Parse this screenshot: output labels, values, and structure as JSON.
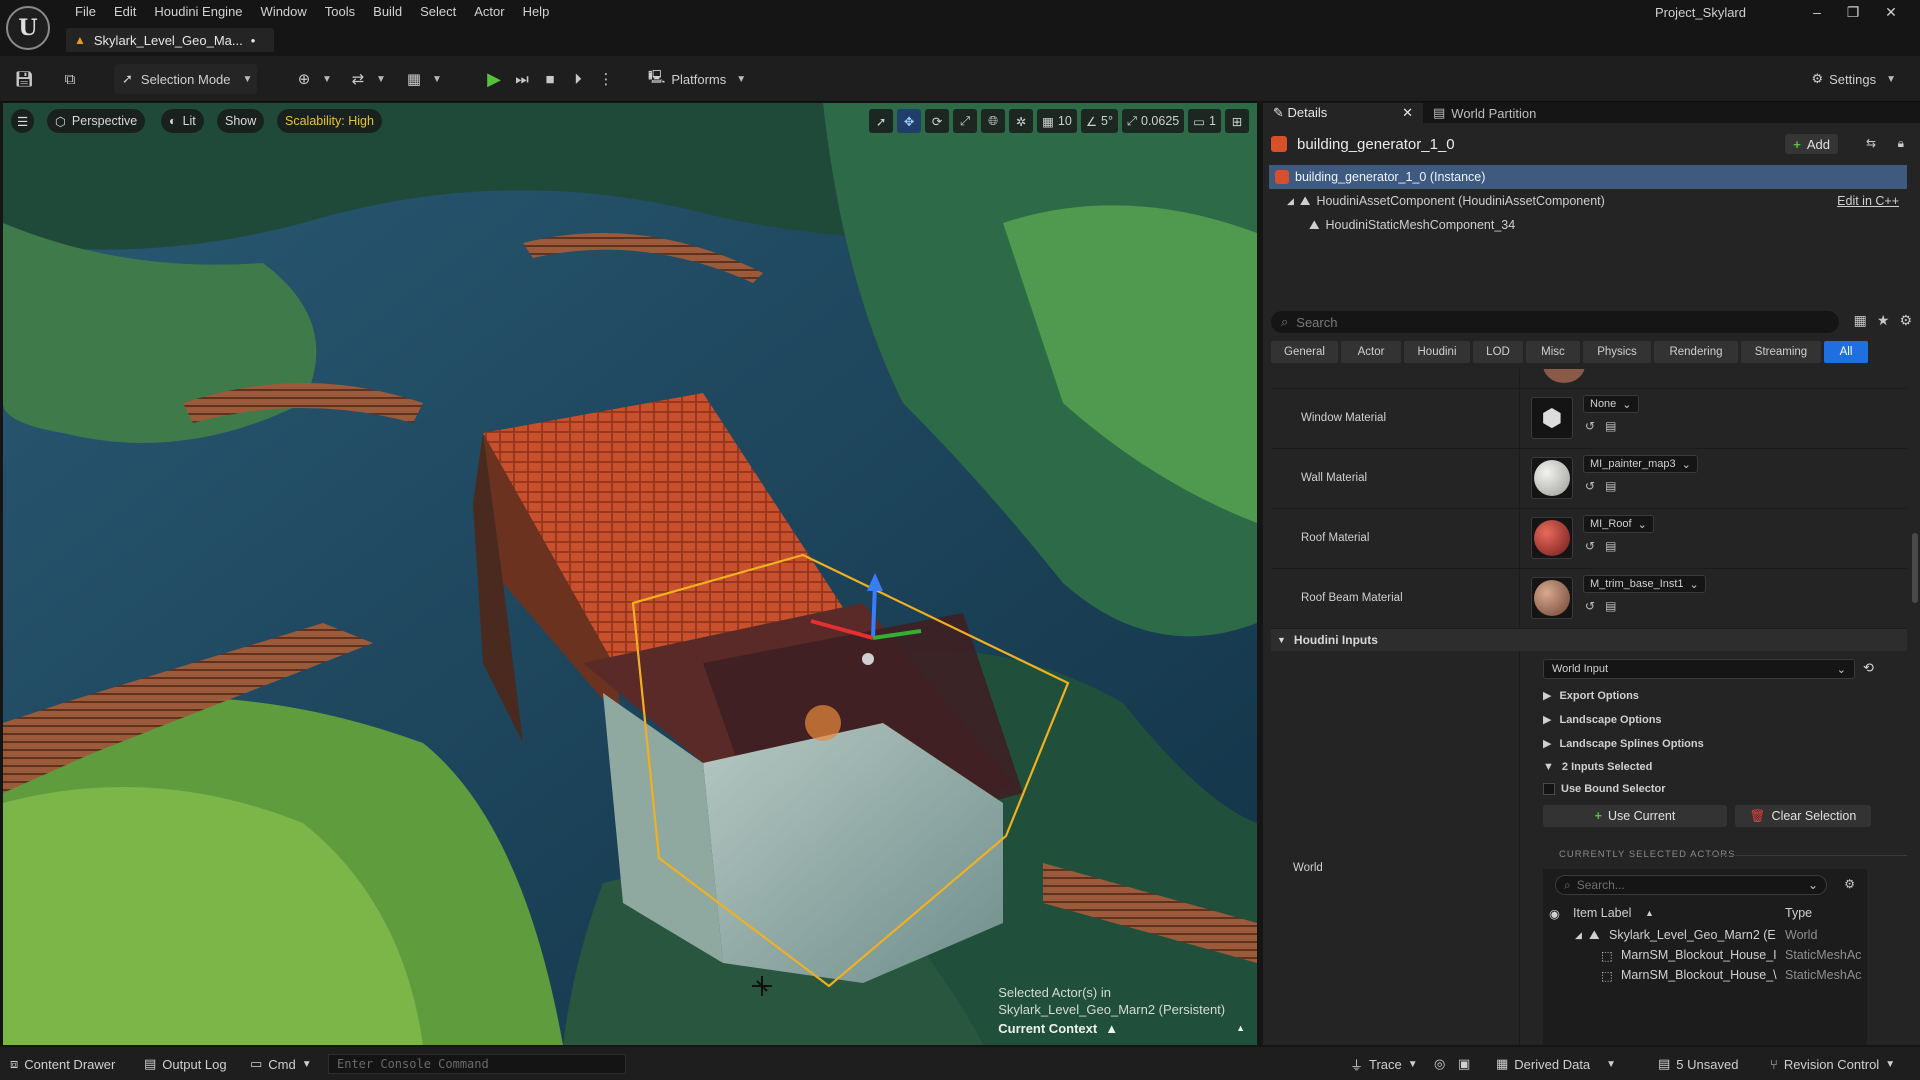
{
  "app": {
    "logo": "U",
    "project": "Project_Skylard"
  },
  "menu": [
    "File",
    "Edit",
    "Houdini Engine",
    "Window",
    "Tools",
    "Build",
    "Select",
    "Actor",
    "Help"
  ],
  "document_tab": {
    "label": "Skylark_Level_Geo_Ma...",
    "modified_mark": "•"
  },
  "toolbar": {
    "selection_mode": "Selection Mode",
    "platforms": "Platforms",
    "settings": "Settings"
  },
  "viewport": {
    "perspective": "Perspective",
    "lit": "Lit",
    "show": "Show",
    "scalability": "Scalability: High",
    "grid_snap": "10",
    "rotation_snap": "5°",
    "scale_snap": "0.0625",
    "camera_speed": "1",
    "status_line1": "Selected Actor(s) in",
    "status_line2": "Skylark_Level_Geo_Marn2 (Persistent)",
    "context_label": "Current Context"
  },
  "panel": {
    "tab_details": "Details",
    "tab_world_partition": "World Partition",
    "actor_name": "building_generator_1_0",
    "add_label": "Add",
    "components": [
      {
        "label": "building_generator_1_0 (Instance)"
      },
      {
        "label": "HoudiniAssetComponent (HoudiniAssetComponent)"
      },
      {
        "label": "HoudiniStaticMeshComponent_34"
      }
    ],
    "edit_cpp": "Edit in C++",
    "search_placeholder": "Search",
    "filters": [
      "General",
      "Actor",
      "Houdini",
      "LOD",
      "Misc",
      "Physics",
      "Rendering",
      "Streaming",
      "All"
    ],
    "active_filter": "All"
  },
  "materials": [
    {
      "label": "Window Material",
      "value": "None",
      "color": "#d8d8d8"
    },
    {
      "label": "Wall Material",
      "value": "MI_painter_map3",
      "color": "#d0d0cc"
    },
    {
      "label": "Roof Material",
      "value": "MI_Roof",
      "color": "#b83a34"
    },
    {
      "label": "Roof Beam Material",
      "value": "M_trim_base_Inst1",
      "color": "#b88770"
    }
  ],
  "houdini_inputs": {
    "header": "Houdini Inputs",
    "world_label": "World",
    "input_type": "World Input",
    "options": [
      "Export Options",
      "Landscape Options",
      "Landscape Splines Options",
      "2 Inputs Selected"
    ],
    "use_bound_selector": "Use Bound Selector",
    "use_current": "Use Current",
    "clear_selection": "Clear Selection",
    "currently_selected": "CURRENTLY SELECTED ACTORS",
    "list_search_placeholder": "Search...",
    "col_item_label": "Item Label",
    "col_type": "Type",
    "rows": [
      {
        "label": "Skylark_Level_Geo_Marn2 (E",
        "type": "World"
      },
      {
        "label": "MarnSM_Blockout_House_I",
        "type": "StaticMeshAc"
      },
      {
        "label": "MarnSM_Blockout_House_\\",
        "type": "StaticMeshAc"
      }
    ]
  },
  "statusbar": {
    "content_drawer": "Content Drawer",
    "output_log": "Output Log",
    "cmd": "Cmd",
    "console_placeholder": "Enter Console Command",
    "trace": "Trace",
    "derived_data": "Derived Data",
    "unsaved": "5 Unsaved",
    "revision_control": "Revision Control"
  },
  "colors": {
    "accent": "#1f6fe0",
    "play": "#56c13a",
    "selection_outline": "#f0b020",
    "scalability": "#e8c23a"
  }
}
